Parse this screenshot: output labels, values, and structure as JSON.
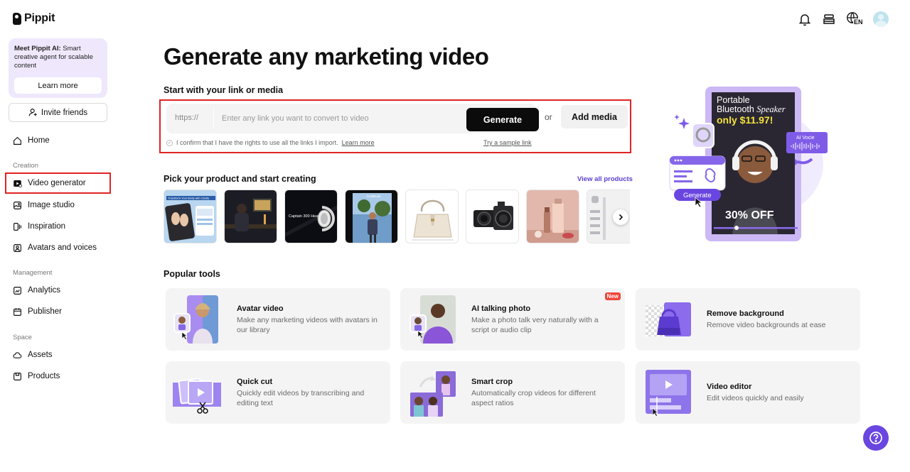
{
  "app": {
    "logo_text": "Pippit"
  },
  "sidebar": {
    "promo": {
      "text_bold": "Meet Pippit AI:",
      "text": " Smart creative agent for scalable content",
      "button": "Learn more"
    },
    "invite": "Invite friends",
    "home": "Home",
    "section_creation": "Creation",
    "video_generator": "Video generator",
    "image_studio": "Image studio",
    "inspiration": "Inspiration",
    "avatars_voices": "Avatars and voices",
    "section_management": "Management",
    "analytics": "Analytics",
    "publisher": "Publisher",
    "section_space": "Space",
    "assets": "Assets",
    "products": "Products"
  },
  "header": {
    "lang": "EN"
  },
  "main": {
    "title": "Generate any marketing video",
    "subhead": "Start with your link or media",
    "link_prefix": "https://",
    "link_placeholder": "Enter any link you want to convert to video",
    "generate": "Generate",
    "or": "or",
    "add_media": "Add media",
    "confirm_text": "I confirm that I have the rights to use all the links I import.",
    "confirm_learn": "Learn more",
    "sample_link": "Try a sample link",
    "pick_title": "Pick your product and start creating",
    "view_all": "View all products",
    "popular_title": "Popular tools"
  },
  "hero": {
    "line1": "Portable",
    "line2a": "Bluetooth ",
    "line2b": "Speaker",
    "price": "only $11.97!",
    "off": "30% OFF",
    "gen": "Generate",
    "ai_voice": "AI Vocie"
  },
  "thumbs": [
    {
      "caption": "Transform Your Body with Clarity"
    },
    {
      "caption": ""
    },
    {
      "caption": "Captain 300 Headset"
    },
    {
      "caption": "Kn0tBook"
    },
    {
      "caption": ""
    },
    {
      "caption": ""
    },
    {
      "caption": ""
    },
    {
      "caption": ""
    }
  ],
  "tools": [
    {
      "name": "Avatar video",
      "desc": "Make any marketing videos with avatars in our library"
    },
    {
      "name": "AI talking photo",
      "desc": "Make a photo talk very naturally with a script or audio clip",
      "badge": "New"
    },
    {
      "name": "Remove background",
      "desc": "Remove video backgrounds at ease"
    },
    {
      "name": "Quick cut",
      "desc": "Quickly edit videos by transcribing and editing text"
    },
    {
      "name": "Smart crop",
      "desc": "Automatically crop videos for different aspect ratios"
    },
    {
      "name": "Video editor",
      "desc": "Edit videos quickly and easily"
    }
  ],
  "colors": {
    "accent": "#6a46e0",
    "highlight": "#e02424",
    "yellow": "#f5e23a"
  }
}
